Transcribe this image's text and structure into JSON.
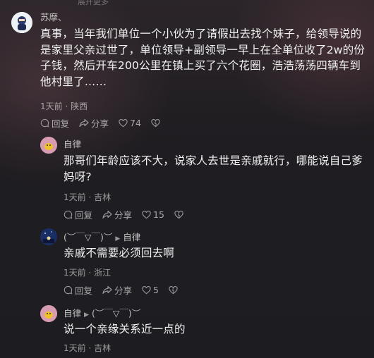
{
  "top_strip_text": "展开更多",
  "comment_main": {
    "username": "苏摩、",
    "text": "真事，当年我们单位一个小伙为了请假出去找个妹子，给领导说的是家里父亲过世了，单位领导+副领导一早上在全单位收了2w的份子钱，然后开车200公里在镇上买了六个花圈，浩浩荡荡四辆车到他村里了……",
    "time": "1天前",
    "location": "陕西",
    "reply_label": "回复",
    "share_label": "分享",
    "likes": "74"
  },
  "reply_1": {
    "username": "自律",
    "text": "那哥们年龄应该不大，说家人去世是亲戚就行，哪能说自己爹妈呀?",
    "time": "1天前",
    "location": "吉林",
    "reply_label": "回复",
    "share_label": "分享",
    "likes": "15"
  },
  "reply_2": {
    "username": "(︶￣▽￣)︶",
    "reply_to": "自律",
    "text": "亲戚不需要必须回去啊",
    "time": "1天前",
    "location": "浙江",
    "reply_label": "回复",
    "share_label": "分享",
    "likes": "5"
  },
  "reply_3": {
    "username": "自律",
    "reply_to": "(︶￣▽￣)︶",
    "text": "说一个亲缘关系近一点的",
    "time": "1天前",
    "location": "吉林"
  },
  "meta_separator": " · ",
  "colors": {
    "background": "#1f1d21",
    "text": "#f2f2f2",
    "muted": "#8c8a8f"
  },
  "icons": [
    "comment-bubble-icon",
    "share-arrow-icon",
    "heart-icon",
    "dislike-heart-icon",
    "reply-arrow-icon"
  ]
}
